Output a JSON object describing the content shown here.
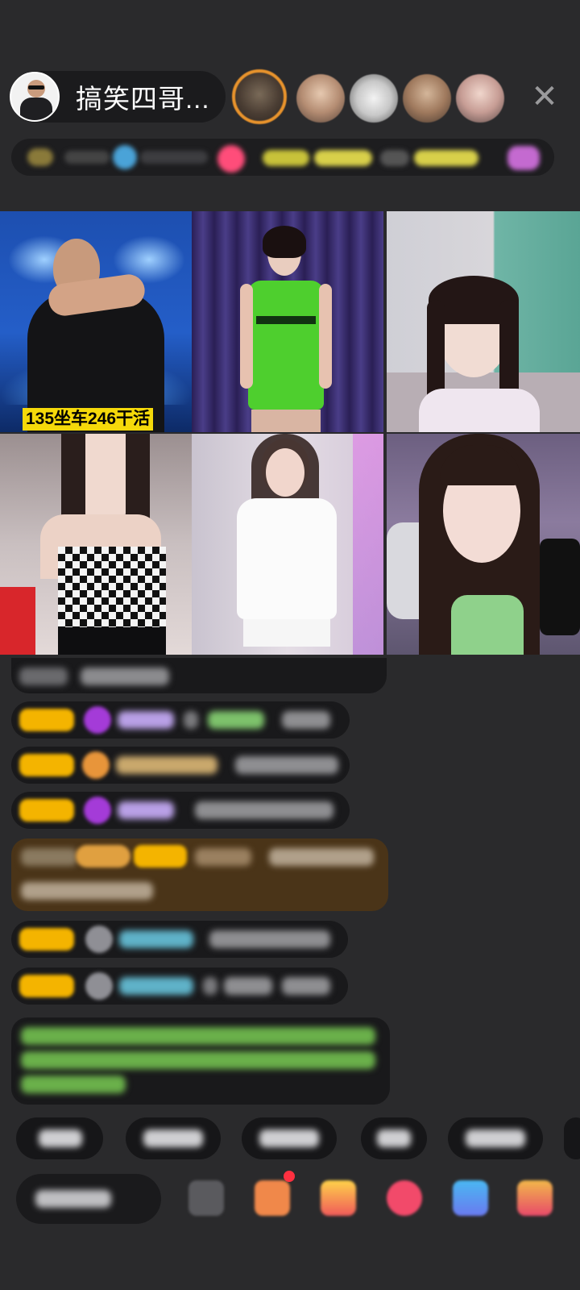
{
  "header": {
    "host_name": "搞笑四哥...",
    "close_symbol": "✕"
  },
  "video_grid": {
    "tiles": [
      {
        "id": "tile-1",
        "caption": "135坐车246干活"
      },
      {
        "id": "tile-2",
        "caption": ""
      },
      {
        "id": "tile-3",
        "caption": ""
      },
      {
        "id": "tile-4",
        "caption": ""
      },
      {
        "id": "tile-5",
        "caption": ""
      },
      {
        "id": "tile-6",
        "caption": ""
      }
    ]
  },
  "colors": {
    "background": "#2a2a2c",
    "caption_bg": "#f5d90a",
    "level_badge": "#f4b400",
    "highlight_row": "#4a3418",
    "system_message_text": "#7ec850"
  }
}
